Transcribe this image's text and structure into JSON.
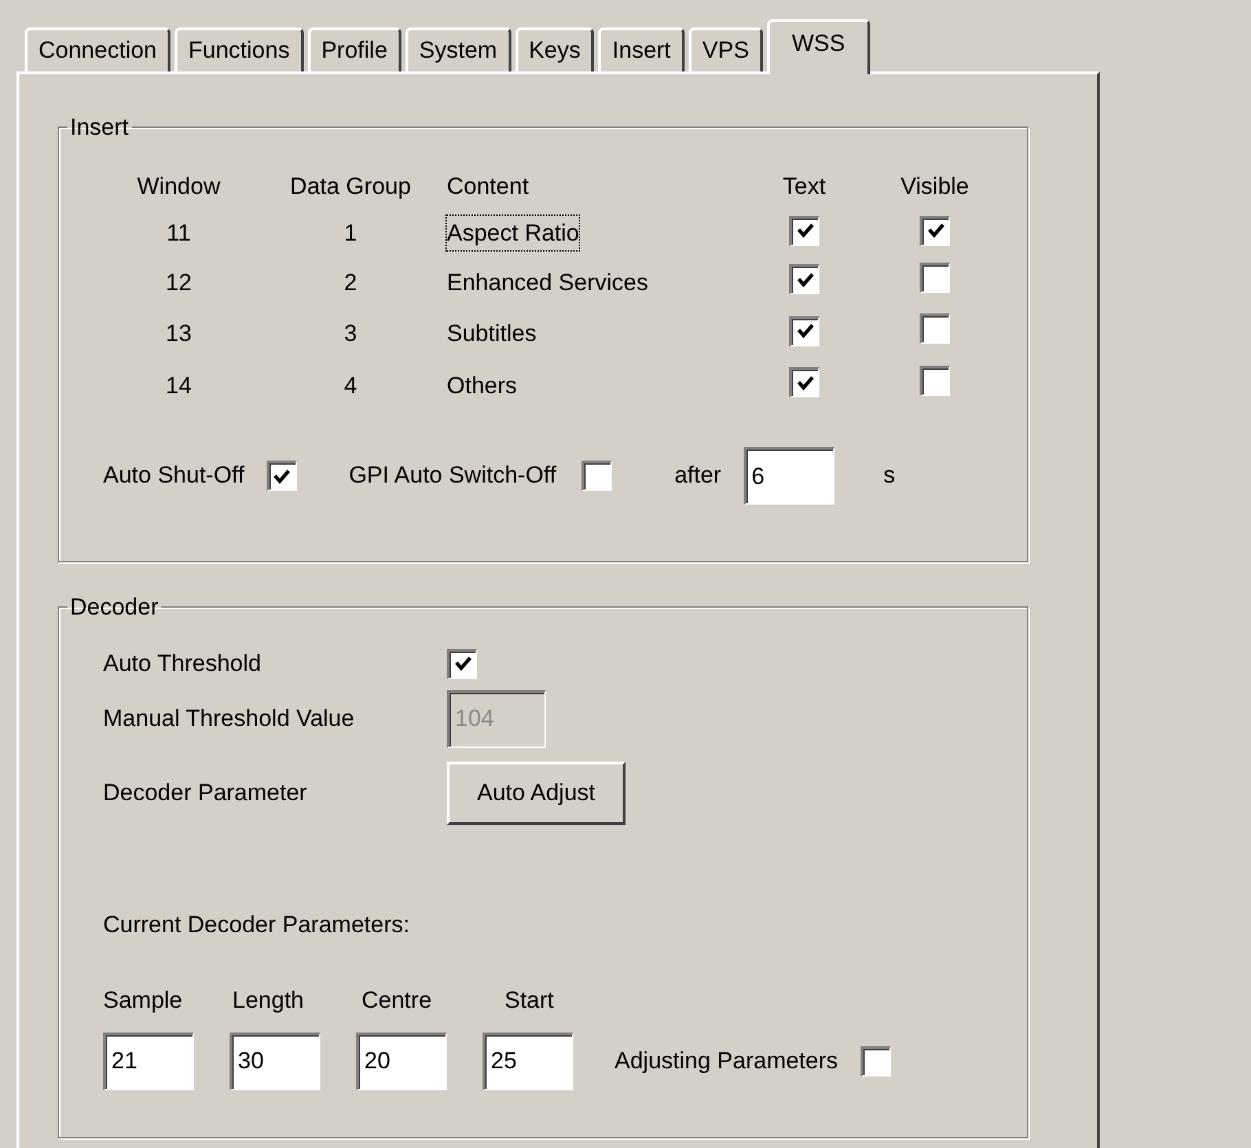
{
  "tabs": [
    {
      "label": "Connection",
      "selected": false
    },
    {
      "label": "Functions",
      "selected": false
    },
    {
      "label": "Profile",
      "selected": false
    },
    {
      "label": "System",
      "selected": false
    },
    {
      "label": "Keys",
      "selected": false
    },
    {
      "label": "Insert",
      "selected": false
    },
    {
      "label": "VPS",
      "selected": false
    },
    {
      "label": "WSS",
      "selected": true
    }
  ],
  "insert": {
    "title": "Insert",
    "columns": [
      "Window",
      "Data Group",
      "Content",
      "Text",
      "Visible"
    ],
    "rows": [
      {
        "window": "11",
        "data_group": "1",
        "content": "Aspect Ratio",
        "focused": true,
        "text": true,
        "visible": true
      },
      {
        "window": "12",
        "data_group": "2",
        "content": "Enhanced Services",
        "focused": false,
        "text": true,
        "visible": false
      },
      {
        "window": "13",
        "data_group": "3",
        "content": "Subtitles",
        "focused": false,
        "text": true,
        "visible": false
      },
      {
        "window": "14",
        "data_group": "4",
        "content": "Others",
        "focused": false,
        "text": true,
        "visible": false
      }
    ],
    "auto_shut_off": {
      "label": "Auto Shut-Off",
      "checked": true
    },
    "gpi_auto_switch_off": {
      "label": "GPI Auto Switch-Off",
      "checked": false
    },
    "after": {
      "label": "after",
      "value": "6",
      "unit": "s"
    }
  },
  "decoder": {
    "title": "Decoder",
    "auto_threshold": {
      "label": "Auto Threshold",
      "checked": true
    },
    "manual_threshold": {
      "label": "Manual Threshold Value",
      "value": "104",
      "disabled": true
    },
    "decoder_parameter": {
      "label": "Decoder Parameter",
      "button": "Auto Adjust"
    },
    "current_title": "Current Decoder Parameters:",
    "params": [
      {
        "label": "Sample",
        "value": "21"
      },
      {
        "label": "Length",
        "value": "30"
      },
      {
        "label": "Centre",
        "value": "20"
      },
      {
        "label": "Start",
        "value": "25"
      }
    ],
    "adjusting": {
      "label": "Adjusting Parameters",
      "checked": false
    }
  }
}
